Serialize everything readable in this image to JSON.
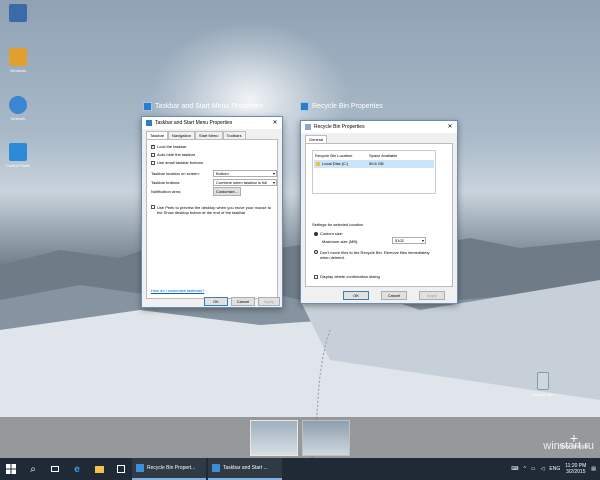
{
  "desktop": {
    "icons": [
      {
        "label": "",
        "color": "#3a6aa8"
      },
      {
        "label": "Windows",
        "color": "#e0a030"
      },
      {
        "label": "Network",
        "color": "#3a86d0"
      },
      {
        "label": "Control Panel",
        "color": "#2c8bd6"
      }
    ],
    "recycle_label": "Recycle Bin"
  },
  "taskview": {
    "window1_title": "Taskbar and Start Menu Properties",
    "window2_title": "Recycle Bin Properties",
    "new_desktop": "New desktop"
  },
  "taskbar_dialog": {
    "title": "Taskbar and Start Menu Properties",
    "tabs": [
      "Taskbar",
      "Navigation",
      "Start Menu",
      "Toolbars"
    ],
    "lock": "Lock the taskbar",
    "autohide": "Auto-hide the taskbar",
    "small": "Use small taskbar buttons",
    "location_label": "Taskbar location on screen:",
    "location_value": "Bottom",
    "buttons_label": "Taskbar buttons:",
    "buttons_value": "Combine when taskbar is full",
    "notif_label": "Notification area:",
    "customize": "Customize...",
    "peek": "Use Peek to preview the desktop when you move your mouse to the Show desktop button at the end of the taskbar",
    "help": "How do I customize taskbars?",
    "ok": "OK",
    "cancel": "Cancel",
    "apply": "Apply"
  },
  "recycle_dialog": {
    "title": "Recycle Bin Properties",
    "tab": "General",
    "col1": "Recycle Bin Location",
    "col2": "Space Available",
    "drive": "Local Disk (C:)",
    "space": "59.6 GB",
    "settings_label": "Settings for selected location",
    "custom": "Custom size:",
    "max_label": "Maximum size (MB):",
    "max_value": "5102",
    "dont_move": "Don't move files to the Recycle Bin. Remove files immediately when deleted.",
    "confirm": "Display delete confirmation dialog",
    "ok": "OK",
    "cancel": "Cancel",
    "apply": "Apply"
  },
  "taskbar": {
    "task1": "Recycle Bin Propert...",
    "task2": "Taskbar and Start ...",
    "lang": "ENG",
    "time": "11:20 PM",
    "date": "3/2/2015"
  },
  "watermark": "winstart.ru"
}
